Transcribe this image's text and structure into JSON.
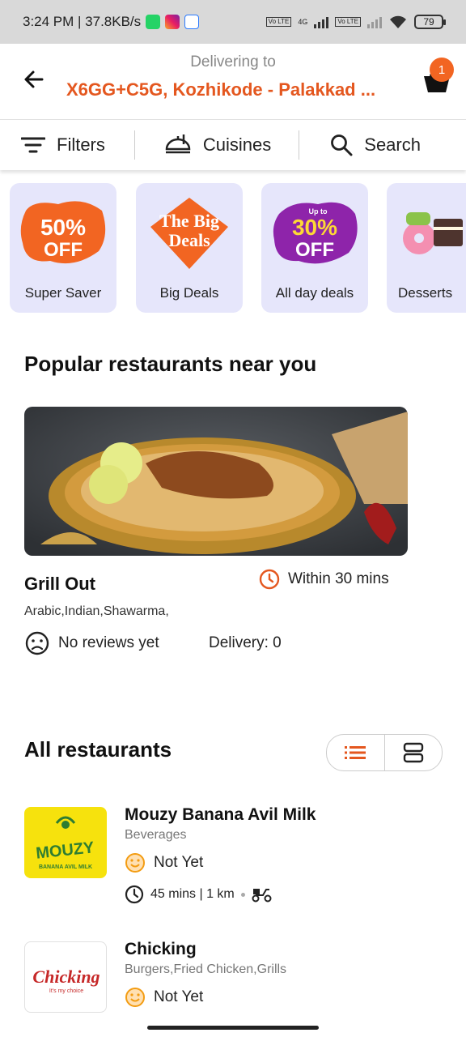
{
  "status_bar": {
    "time_speed": "3:24 PM | 37.8KB/s",
    "network_4g": "4G",
    "volte_1": "Vo LTE",
    "volte_2": "Vo LTE",
    "battery": "79"
  },
  "header": {
    "delivering_label": "Delivering to",
    "address": "X6GG+C5G, Kozhikode - Palakkad ...",
    "cart_count": "1"
  },
  "filter_bar": {
    "filters": "Filters",
    "cuisines": "Cuisines",
    "search": "Search"
  },
  "offers": [
    {
      "label": "Super Saver",
      "badge_big": "50%",
      "badge_small": "OFF",
      "color": "#f26522"
    },
    {
      "label": "Big Deals",
      "badge_big": "The Big",
      "badge_small": "Deals",
      "color": "#f26522"
    },
    {
      "label": "All day deals",
      "badge_top": "Up to",
      "badge_big": "30%",
      "badge_small": "OFF",
      "color": "#8e24aa"
    },
    {
      "label": "Desserts"
    }
  ],
  "popular": {
    "title": "Popular restaurants near you",
    "restaurant": {
      "name": "Grill Out",
      "time": "Within 30 mins",
      "cuisines": "Arabic,Indian,Shawarma,",
      "reviews": "No reviews yet",
      "delivery": "Delivery: 0"
    }
  },
  "all_restaurants": {
    "title": "All restaurants",
    "items": [
      {
        "name": "Mouzy Banana Avil Milk",
        "cuisine": "Beverages",
        "rating": "Not Yet",
        "meta": "45 mins | 1 km",
        "logo_text": "MOUZY",
        "logo_sub": "BANANA AVIL MILK"
      },
      {
        "name": "Chicking",
        "cuisine": "Burgers,Fried Chicken,Grills",
        "rating": "Not Yet",
        "logo_text": "Chicking",
        "logo_sub": "It's my choice"
      }
    ]
  },
  "colors": {
    "accent": "#e4571f",
    "badge": "#f26522",
    "card_bg": "#e6e6fb"
  }
}
